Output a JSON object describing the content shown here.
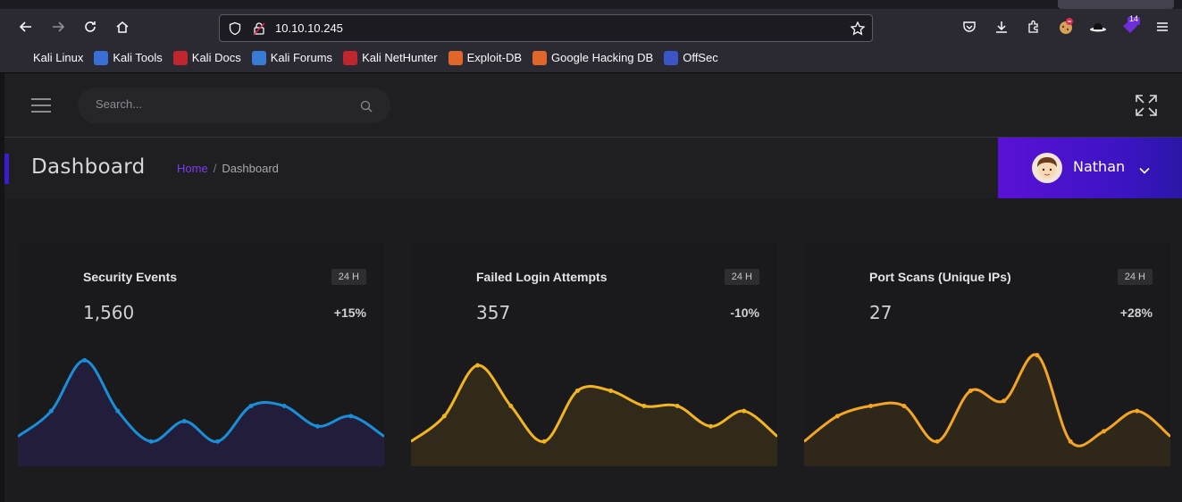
{
  "browser": {
    "url": "10.10.10.245",
    "extension_badge": "14",
    "bookmarks": [
      {
        "label": "Kali Linux",
        "color": "#2b2a33"
      },
      {
        "label": "Kali Tools",
        "color": "#3b6fd8"
      },
      {
        "label": "Kali Docs",
        "color": "#c0262d"
      },
      {
        "label": "Kali Forums",
        "color": "#3a7bd5"
      },
      {
        "label": "Kali NetHunter",
        "color": "#c0262d"
      },
      {
        "label": "Exploit-DB",
        "color": "#e0662a"
      },
      {
        "label": "Google Hacking DB",
        "color": "#e0662a"
      },
      {
        "label": "OffSec",
        "color": "#3a55c8"
      }
    ]
  },
  "header": {
    "search_placeholder": "Search..."
  },
  "titlebar": {
    "title": "Dashboard",
    "breadcrumb_home": "Home",
    "breadcrumb_sep": "/",
    "breadcrumb_current": "Dashboard"
  },
  "user": {
    "name": "Nathan"
  },
  "cards": [
    {
      "title": "Security Events",
      "badge": "24 H",
      "value": "1,560",
      "delta": "+15%",
      "color": "#1a8fd8",
      "fill": "#221d3a"
    },
    {
      "title": "Failed Login Attempts",
      "badge": "24 H",
      "value": "357",
      "delta": "-10%",
      "color": "#f2b51f",
      "fill": "#312919"
    },
    {
      "title": "Port Scans (Unique IPs)",
      "badge": "24 H",
      "value": "27",
      "delta": "+28%",
      "color": "#f5a524",
      "fill": "#2f2719"
    }
  ],
  "chart_data": [
    {
      "type": "area",
      "series": [
        {
          "values": [
            5,
            10,
            20,
            10,
            4,
            8,
            4,
            11,
            11,
            7,
            9,
            5
          ]
        }
      ],
      "ylim": [
        0,
        22
      ]
    },
    {
      "type": "area",
      "series": [
        {
          "values": [
            4,
            9,
            19,
            11,
            4,
            14,
            14,
            11,
            11,
            7,
            10,
            5
          ]
        }
      ],
      "ylim": [
        0,
        22
      ]
    },
    {
      "type": "area",
      "series": [
        {
          "values": [
            4,
            9,
            11,
            11,
            4,
            14,
            12,
            21,
            4,
            6,
            10,
            5
          ]
        }
      ],
      "ylim": [
        0,
        22
      ]
    }
  ]
}
